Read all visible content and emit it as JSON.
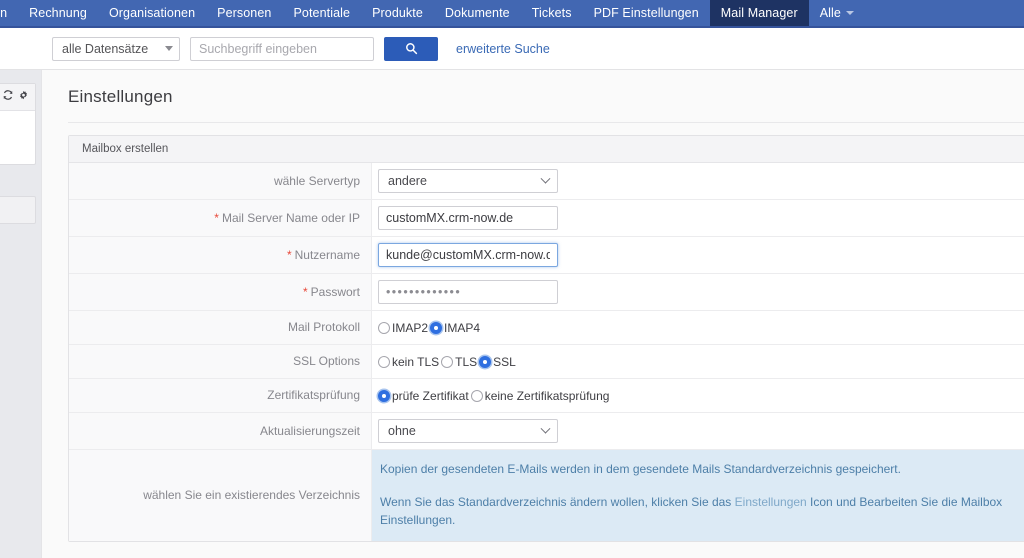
{
  "topnav": {
    "items": [
      {
        "label": "gen",
        "active": false,
        "caret": false,
        "clipped": true
      },
      {
        "label": "Rechnung",
        "active": false,
        "caret": false
      },
      {
        "label": "Organisationen",
        "active": false,
        "caret": false
      },
      {
        "label": "Personen",
        "active": false,
        "caret": false
      },
      {
        "label": "Potentiale",
        "active": false,
        "caret": false
      },
      {
        "label": "Produkte",
        "active": false,
        "caret": false
      },
      {
        "label": "Dokumente",
        "active": false,
        "caret": false
      },
      {
        "label": "Tickets",
        "active": false,
        "caret": false
      },
      {
        "label": "PDF Einstellungen",
        "active": false,
        "caret": false
      },
      {
        "label": "Mail Manager",
        "active": true,
        "caret": false
      },
      {
        "label": "Alle",
        "active": false,
        "caret": true
      }
    ],
    "active_color": "#1e3363",
    "bar_color": "#4267b2"
  },
  "search": {
    "scope_value": "alle Datensätze",
    "input_value": "",
    "placeholder": "Suchbegriff eingeben",
    "button_icon": "search-icon",
    "advanced_link": "erweiterte Suche",
    "button_color": "#2c5cb8",
    "link_color": "#3a6ab5"
  },
  "left_rail": {
    "refresh_icon": "refresh-icon",
    "gear_icon": "gear-icon"
  },
  "page": {
    "title": "Einstellungen"
  },
  "panel": {
    "header": "Mailbox erstellen",
    "rows": {
      "servertype": {
        "label": "wähle Servertyp",
        "required": false,
        "value": "andere"
      },
      "mailserver": {
        "label": "Mail Server Name oder IP",
        "required": true,
        "value": "customMX.crm-now.de"
      },
      "username": {
        "label": "Nutzername",
        "required": true,
        "value": "kunde@customMX.crm-now.de",
        "focused": true
      },
      "password": {
        "label": "Passwort",
        "required": true,
        "value": "•••••••••••••"
      },
      "protocol": {
        "label": "Mail Protokoll",
        "options": [
          {
            "label": "IMAP2",
            "selected": false
          },
          {
            "label": "IMAP4",
            "selected": true
          }
        ]
      },
      "ssl": {
        "label": "SSL Options",
        "options": [
          {
            "label": "kein TLS",
            "selected": false
          },
          {
            "label": "TLS",
            "selected": false
          },
          {
            "label": "SSL",
            "selected": true
          }
        ]
      },
      "certcheck": {
        "label": "Zertifikatsprüfung",
        "options": [
          {
            "label": "prüfe Zertifikat",
            "selected": true
          },
          {
            "label": "keine Zertifikatsprüfung",
            "selected": false
          }
        ]
      },
      "refreshtime": {
        "label": "Aktualisierungszeit",
        "value": "ohne"
      },
      "directory": {
        "label": "wählen Sie ein existierendes Verzeichnis",
        "info_line_1": "Kopien der gesendeten E-Mails werden in dem gesendete Mails Standardverzeichnis gespeichert.",
        "info_line_2_a": "Wenn Sie das Standardverzeichnis ändern wollen, klicken Sie das ",
        "info_line_2_em": "Einstellungen",
        "info_line_2_b": " Icon und Bearbeiten Sie die Mailbox Einstellungen.",
        "info_bg": "#dceaf5",
        "info_color": "#4d7fa8"
      }
    }
  }
}
